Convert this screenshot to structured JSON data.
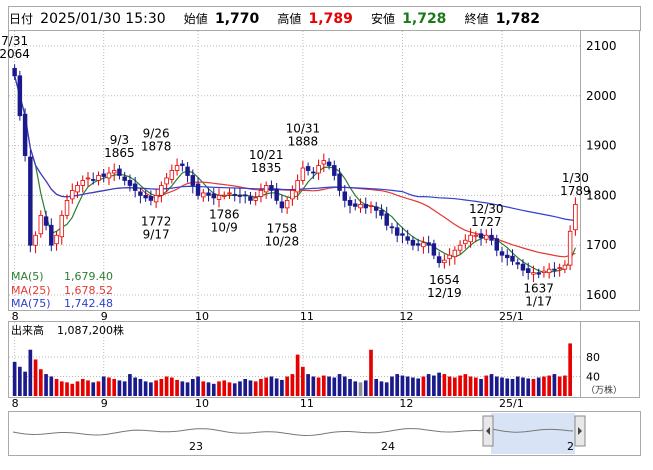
{
  "header": {
    "date_label": "日付",
    "datetime": "2025/01/30 15:30",
    "open_label": "始値",
    "open_value": "1,770",
    "high_label": "高値",
    "high_value": "1,789",
    "low_label": "安値",
    "low_value": "1,728",
    "close_label": "終値",
    "close_value": "1,782"
  },
  "legend": {
    "ma5": "MA(5)",
    "ma5_value": "1,679.40",
    "ma25": "MA(25)",
    "ma25_value": "1,678.52",
    "ma75": "MA(75)",
    "ma75_value": "1,742.48"
  },
  "volume_label": "出来高",
  "volume_value": "1,087,200株",
  "volume_unit": "（万株）",
  "colors": {
    "up": "#e60000",
    "down": "#1a1a8c",
    "ma5": "#2e7d32",
    "ma25": "#e53935",
    "ma75": "#2f3fd1",
    "grid": "#bbbbbb",
    "volume_gray": "#909090"
  },
  "chart_data": [
    {
      "type": "candlestick",
      "price_ticks": [
        1600,
        1700,
        1800,
        1900,
        2000,
        2100
      ],
      "price_range": [
        1570,
        2130
      ],
      "month_labels": [
        {
          "day": 0,
          "label": "8"
        },
        {
          "day": 17,
          "label": "9"
        },
        {
          "day": 35,
          "label": "10"
        },
        {
          "day": 55,
          "label": "11"
        },
        {
          "day": 74,
          "label": "12"
        },
        {
          "day": 93,
          "label": "25/1"
        }
      ],
      "annotations": [
        {
          "day": 0,
          "date": "7/31",
          "value": "2064",
          "pos": "above"
        },
        {
          "day": 20,
          "date": "9/3",
          "value": "1865",
          "pos": "above"
        },
        {
          "day": 27,
          "date": "9/26",
          "value": "1878",
          "pos": "above"
        },
        {
          "day": 48,
          "date": "10/21",
          "value": "1835",
          "pos": "above"
        },
        {
          "day": 55,
          "date": "10/31",
          "value": "1888",
          "pos": "above"
        },
        {
          "day": 27,
          "date": "9/17",
          "value": "1772",
          "pos": "below"
        },
        {
          "day": 40,
          "date": "10/9",
          "value": "1786",
          "pos": "below"
        },
        {
          "day": 51,
          "date": "10/28",
          "value": "1758",
          "pos": "below"
        },
        {
          "day": 82,
          "date": "12/19",
          "value": "1654",
          "pos": "below"
        },
        {
          "day": 90,
          "date": "12/30",
          "value": "1727",
          "pos": "above"
        },
        {
          "day": 100,
          "date": "1/17",
          "value": "1637",
          "pos": "below"
        },
        {
          "day": 107,
          "date": "1/30",
          "value": "1789",
          "pos": "above"
        }
      ],
      "closes": [
        2040,
        1960,
        1880,
        1700,
        1720,
        1760,
        1740,
        1700,
        1720,
        1760,
        1790,
        1810,
        1820,
        1830,
        1835,
        1830,
        1840,
        1838,
        1845,
        1850,
        1840,
        1830,
        1820,
        1810,
        1800,
        1795,
        1790,
        1800,
        1820,
        1835,
        1850,
        1860,
        1860,
        1840,
        1820,
        1800,
        1805,
        1800,
        1795,
        1800,
        1800,
        1805,
        1800,
        1798,
        1800,
        1790,
        1795,
        1810,
        1820,
        1810,
        1790,
        1775,
        1790,
        1810,
        1830,
        1855,
        1850,
        1845,
        1860,
        1870,
        1860,
        1840,
        1810,
        1790,
        1780,
        1778,
        1782,
        1775,
        1780,
        1770,
        1760,
        1740,
        1735,
        1720,
        1720,
        1710,
        1700,
        1700,
        1705,
        1700,
        1680,
        1665,
        1670,
        1680,
        1690,
        1700,
        1710,
        1720,
        1720,
        1715,
        1720,
        1710,
        1690,
        1680,
        1675,
        1668,
        1662,
        1650,
        1645,
        1645,
        1642,
        1648,
        1652,
        1650,
        1655,
        1660,
        1728,
        1782
      ],
      "volumes": [
        70,
        60,
        50,
        95,
        75,
        55,
        45,
        40,
        35,
        30,
        28,
        25,
        30,
        35,
        32,
        28,
        30,
        40,
        38,
        35,
        32,
        30,
        45,
        38,
        35,
        30,
        28,
        32,
        35,
        40,
        38,
        33,
        30,
        28,
        35,
        40,
        30,
        28,
        25,
        30,
        32,
        28,
        26,
        30,
        35,
        32,
        30,
        35,
        38,
        40,
        36,
        33,
        40,
        45,
        85,
        60,
        45,
        40,
        38,
        42,
        40,
        38,
        45,
        40,
        35,
        30,
        28,
        32,
        95,
        35,
        30,
        28,
        40,
        45,
        42,
        40,
        38,
        36,
        40,
        45,
        42,
        48,
        45,
        40,
        38,
        42,
        45,
        40,
        38,
        35,
        42,
        45,
        40,
        38,
        36,
        35,
        40,
        38,
        36,
        35,
        38,
        40,
        42,
        45,
        40,
        42,
        108
      ],
      "volume_ticks": [
        40,
        80
      ],
      "volume_max": 115
    },
    {
      "type": "area",
      "name": "scroll-overview",
      "labels": [
        {
          "pos": 0.3,
          "label": "23"
        },
        {
          "pos": 0.62,
          "label": "24"
        },
        {
          "pos": 0.93,
          "label": "2"
        }
      ]
    }
  ]
}
